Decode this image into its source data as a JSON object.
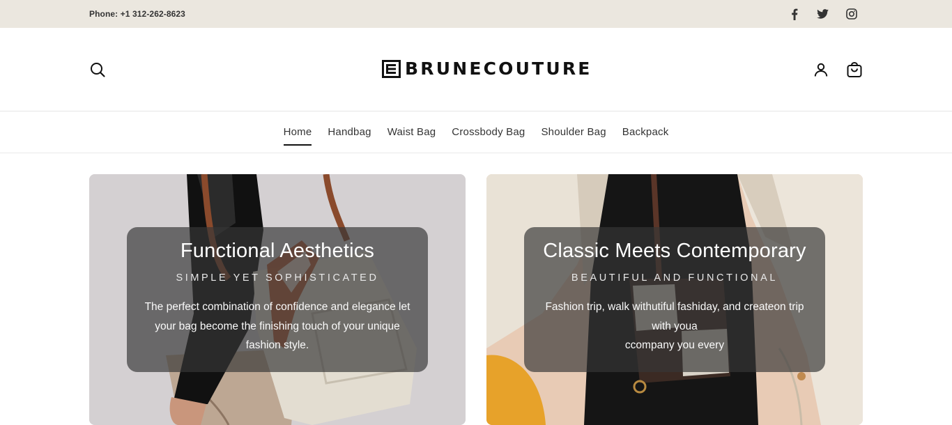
{
  "topbar": {
    "phone": "Phone: +1 312-262-8623",
    "social": [
      {
        "icon": "facebook-icon"
      },
      {
        "icon": "twitter-icon"
      },
      {
        "icon": "instagram-icon"
      }
    ]
  },
  "header": {
    "logo_text": "BRUNECOUTURE",
    "icons": [
      "search-icon",
      "account-icon",
      "cart-icon"
    ]
  },
  "nav": {
    "items": [
      {
        "label": "Home",
        "active": true
      },
      {
        "label": "Handbag"
      },
      {
        "label": "Waist Bag"
      },
      {
        "label": "Crossbody Bag"
      },
      {
        "label": "Shoulder Bag"
      },
      {
        "label": "Backpack"
      }
    ]
  },
  "banners": [
    {
      "title": "Functional Aesthetics",
      "subtitle": "SIMPLE YET SOPHISTICATED",
      "body": "The perfect combination of confidence and elegance let your bag become the finishing touch of your unique fashion style."
    },
    {
      "title": "Classic Meets Contemporary",
      "subtitle": "BEAUTIFUL AND FUNCTIONAL",
      "body": "Fashion trip, walk withutiful fashiday, and createon trip with youa\nccompany you every"
    }
  ],
  "colors": {
    "topbar_bg": "#ebe7df",
    "overlay_bg": "#373737",
    "text_dark": "#111111"
  }
}
